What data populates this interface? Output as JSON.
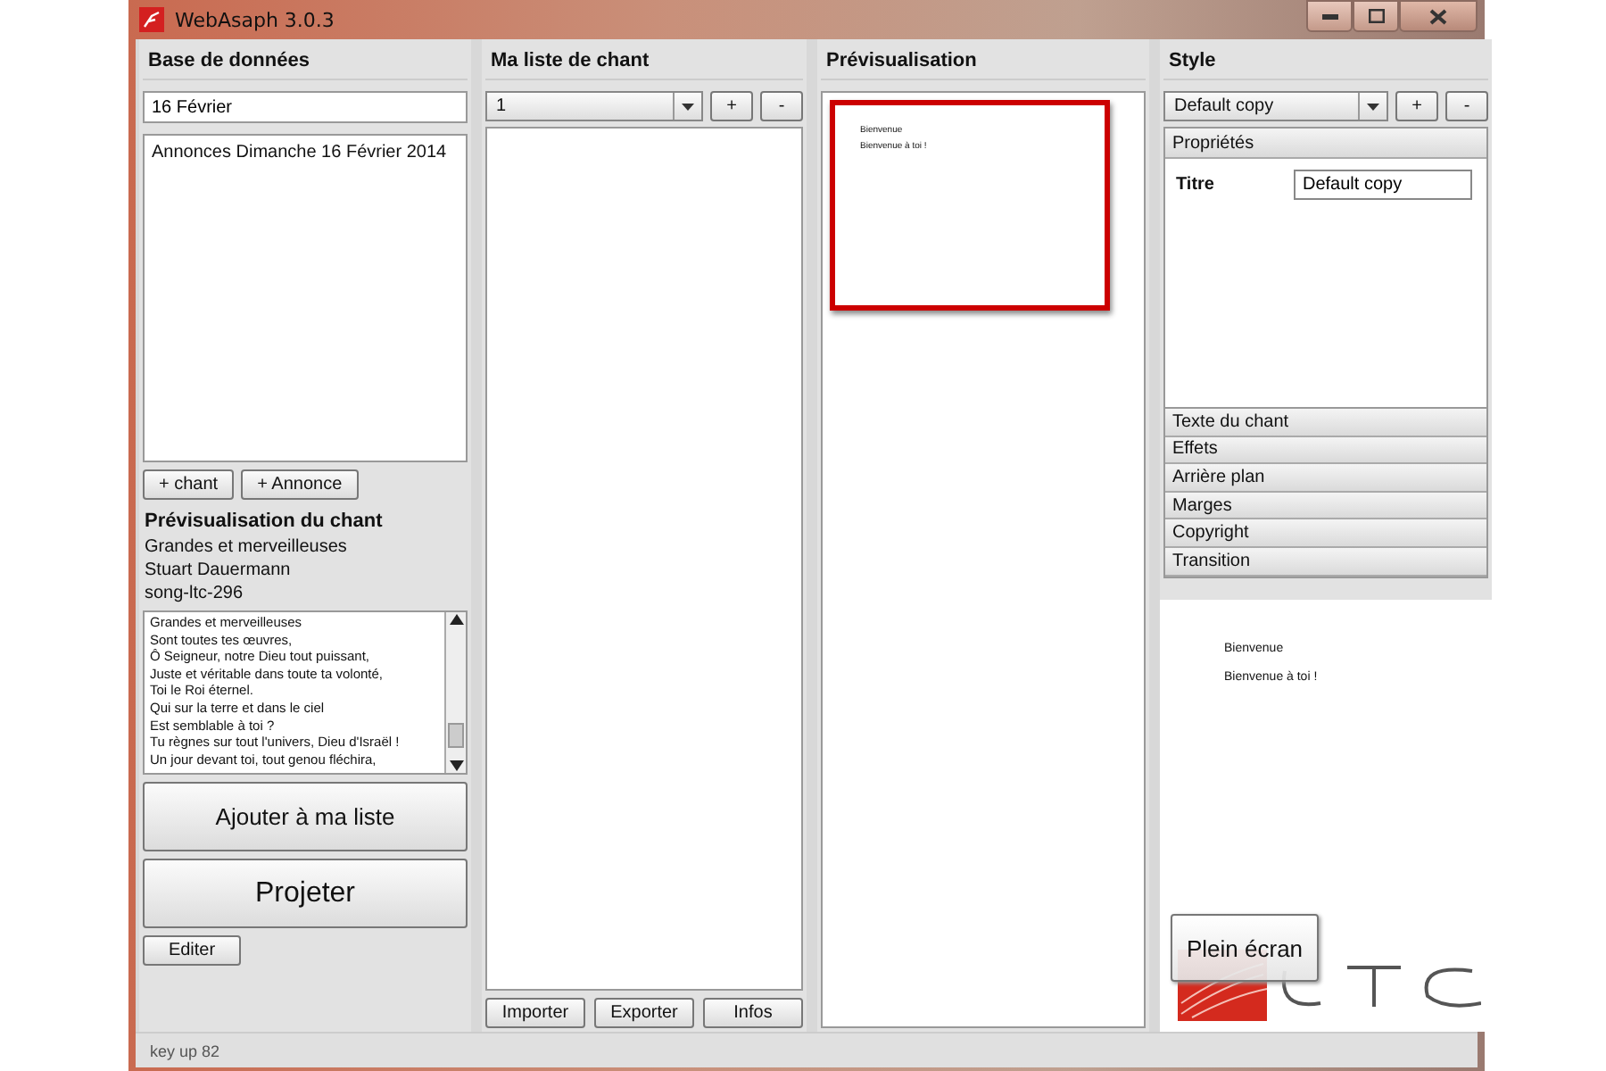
{
  "window": {
    "title": "WebAsaph 3.0.3"
  },
  "database": {
    "heading": "Base de données",
    "search": "16 Février",
    "items": [
      {
        "label": "Annonces Dimanche 16 Février 2014",
        "selected": false
      }
    ],
    "buttons": [
      "+ chant",
      "+ Annonce"
    ]
  },
  "song_preview": {
    "heading": "Prévisualisation du chant",
    "title": "Grandes et merveilleuses",
    "author": "Stuart Dauermann",
    "code": "song-ltc-296",
    "lyrics": [
      "Grandes et merveilleuses",
      "Sont toutes tes œuvres,",
      "Ô Seigneur, notre Dieu tout puissant,",
      "Juste et véritable dans toute ta volonté,",
      "Toi le Roi éternel.",
      "Qui sur la terre et dans le ciel",
      "Est semblable à toi ?",
      "Tu règnes sur tout l'univers, Dieu d'Israël !",
      "Un jour devant toi, tout genou fléchira,"
    ],
    "add_button": "Ajouter à ma liste",
    "project_button": "Projeter",
    "edit_button": "Editer"
  },
  "playlist": {
    "heading": "Ma liste de chant",
    "select": "1",
    "add": "+",
    "remove": "-",
    "buttons": [
      "Importer",
      "Exporter",
      "Infos"
    ]
  },
  "preview": {
    "heading": "Prévisualisation",
    "slides": [
      {
        "lines": [
          "Bienvenue",
          "Bienvenue à toi !"
        ],
        "selected": true
      }
    ]
  },
  "style": {
    "heading": "Style",
    "select": "Default copy",
    "add": "+",
    "remove": "-",
    "sections": [
      {
        "label": "Propriétés",
        "expanded": true
      },
      {
        "label": "Texte du chant",
        "expanded": false
      },
      {
        "label": "Effets",
        "expanded": false
      },
      {
        "label": "Arrière plan",
        "expanded": false
      },
      {
        "label": "Marges",
        "expanded": false
      },
      {
        "label": "Copyright",
        "expanded": false
      },
      {
        "label": "Transition",
        "expanded": false
      }
    ],
    "properties": [
      {
        "label": "Titre",
        "value": "Default copy"
      }
    ],
    "screen_lines": [
      "Bienvenue",
      "Bienvenue à toi !"
    ],
    "fullscreen_button": "Plein écran"
  },
  "status_bar": "key up 82"
}
